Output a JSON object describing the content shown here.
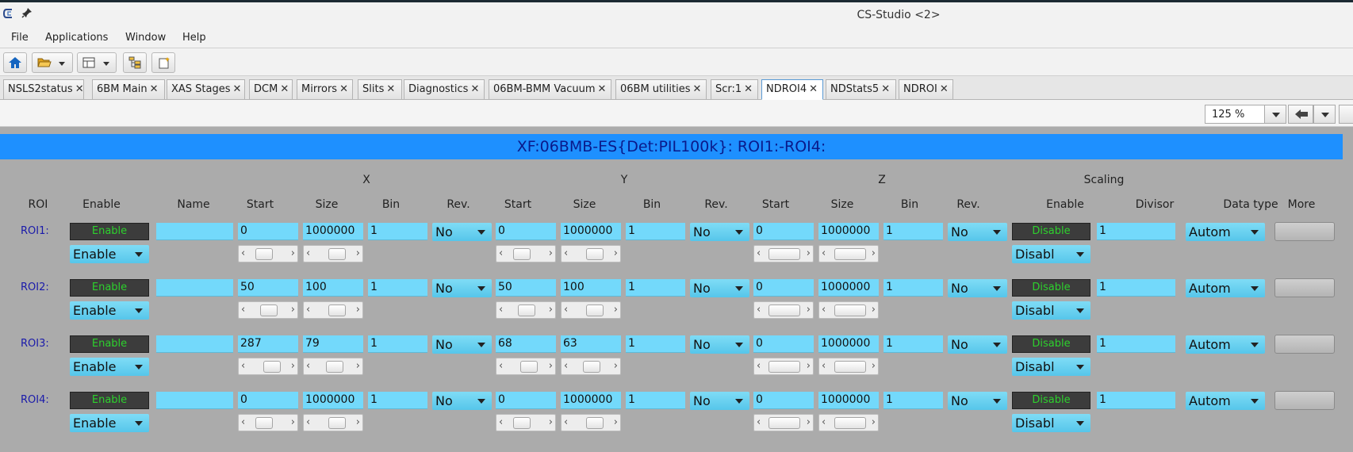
{
  "window": {
    "title": "CS-Studio <2>"
  },
  "menu": [
    "File",
    "Applications",
    "Window",
    "Help"
  ],
  "tabs": [
    {
      "label": "NSLS2status",
      "active": false
    },
    {
      "label": "6BM Main",
      "active": false
    },
    {
      "label": "XAS Stages",
      "active": false
    },
    {
      "label": "DCM",
      "active": false
    },
    {
      "label": "Mirrors",
      "active": false
    },
    {
      "label": "Slits",
      "active": false
    },
    {
      "label": "Diagnostics",
      "active": false
    },
    {
      "label": "06BM-BMM Vacuum",
      "active": false
    },
    {
      "label": "06BM utilities",
      "active": false
    },
    {
      "label": "Scr:1",
      "active": false
    },
    {
      "label": "NDROI4",
      "active": true
    },
    {
      "label": "NDStats5",
      "active": false
    },
    {
      "label": "NDROI",
      "active": false
    }
  ],
  "tab_close": "✕",
  "zoom": {
    "value": "125 %"
  },
  "banner": "XF:06BMB-ES{Det:PIL100k}: ROI1:-ROI4:",
  "groups": {
    "x": "X",
    "y": "Y",
    "z": "Z",
    "scaling": "Scaling"
  },
  "columns": {
    "roi": "ROI",
    "enable": "Enable",
    "name": "Name",
    "start": "Start",
    "size": "Size",
    "bin": "Bin",
    "rev": "Rev.",
    "sc_enable": "Enable",
    "divisor": "Divisor",
    "data_type": "Data type",
    "more": "More"
  },
  "rows": [
    {
      "label": "ROI1:",
      "enable_btn": "Enable",
      "enable_sel": "Enable",
      "name": "",
      "x": {
        "start": "0",
        "size": "1000000",
        "bin": "1",
        "rev": "No",
        "start_pos": 0.25,
        "size_pos": 0.65
      },
      "y": {
        "start": "0",
        "size": "1000000",
        "bin": "1",
        "rev": "No",
        "start_pos": 0.25,
        "size_pos": 0.65
      },
      "z": {
        "start": "0",
        "size": "1000000",
        "bin": "1",
        "rev": "No",
        "start_pos": 0.5,
        "size_pos": 0.65
      },
      "scaling": {
        "enable_btn": "Disable",
        "enable_sel": "Disabl",
        "divisor": "1"
      },
      "data_type": "Autom"
    },
    {
      "label": "ROI2:",
      "enable_btn": "Enable",
      "enable_sel": "Enable",
      "name": "",
      "x": {
        "start": "50",
        "size": "100",
        "bin": "1",
        "rev": "No",
        "start_pos": 0.5,
        "size_pos": 0.65
      },
      "y": {
        "start": "50",
        "size": "100",
        "bin": "1",
        "rev": "No",
        "start_pos": 0.5,
        "size_pos": 0.65
      },
      "z": {
        "start": "0",
        "size": "1000000",
        "bin": "1",
        "rev": "No",
        "start_pos": 0.5,
        "size_pos": 0.65
      },
      "scaling": {
        "enable_btn": "Disable",
        "enable_sel": "Disabl",
        "divisor": "1"
      },
      "data_type": "Autom"
    },
    {
      "label": "ROI3:",
      "enable_btn": "Enable",
      "enable_sel": "Enable",
      "name": "",
      "x": {
        "start": "287",
        "size": "79",
        "bin": "1",
        "rev": "No",
        "start_pos": 0.65,
        "size_pos": 0.55
      },
      "y": {
        "start": "68",
        "size": "63",
        "bin": "1",
        "rev": "No",
        "start_pos": 0.6,
        "size_pos": 0.5
      },
      "z": {
        "start": "0",
        "size": "1000000",
        "bin": "1",
        "rev": "No",
        "start_pos": 0.5,
        "size_pos": 0.65
      },
      "scaling": {
        "enable_btn": "Disable",
        "enable_sel": "Disabl",
        "divisor": "1"
      },
      "data_type": "Autom"
    },
    {
      "label": "ROI4:",
      "enable_btn": "Enable",
      "enable_sel": "Enable",
      "name": "",
      "x": {
        "start": "0",
        "size": "1000000",
        "bin": "1",
        "rev": "No",
        "start_pos": 0.25,
        "size_pos": 0.65
      },
      "y": {
        "start": "0",
        "size": "1000000",
        "bin": "1",
        "rev": "No",
        "start_pos": 0.25,
        "size_pos": 0.65
      },
      "z": {
        "start": "0",
        "size": "1000000",
        "bin": "1",
        "rev": "No",
        "start_pos": 0.5,
        "size_pos": 0.65
      },
      "scaling": {
        "enable_btn": "Disable",
        "enable_sel": "Disabl",
        "divisor": "1"
      },
      "data_type": "Autom"
    }
  ],
  "colors": {
    "banner": "#1e90ff",
    "field": "#73d9fb",
    "led_on": "#2dd12d",
    "panel": "#ababab"
  },
  "icons": [
    "app-logo-icon",
    "pin-icon",
    "home-icon",
    "folder-open-icon",
    "layout-icon",
    "tree-icon",
    "new-display-icon",
    "back-arrow-icon"
  ]
}
